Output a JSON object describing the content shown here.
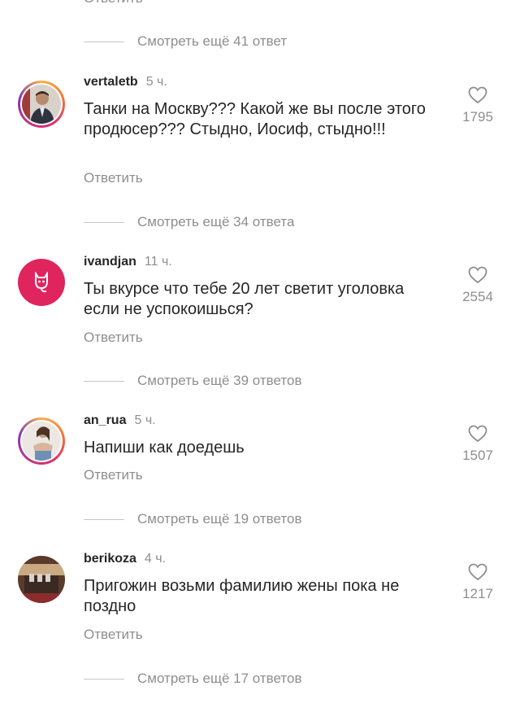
{
  "top_reply_label": "Ответить",
  "view_more": [
    "Смотреть ещё 41 ответ",
    "Смотреть ещё 34 ответа",
    "Смотреть ещё 39 ответов",
    "Смотреть ещё 19 ответов",
    "Смотреть ещё 17 ответов"
  ],
  "comments": [
    {
      "username": "vertaletb",
      "time": "5 ч.",
      "text": "Танки на Москву??? Какой же вы после этого продюсер??? Стыдно, Иосиф, стыдно!!!",
      "likes": "1795",
      "reply_label": "Ответить"
    },
    {
      "username": "ivandjan",
      "time": "11 ч.",
      "text": "Ты вкурсе что тебе 20 лет светит уголовка если не успокоишься?",
      "likes": "2554",
      "reply_label": "Ответить"
    },
    {
      "username": "an_rua",
      "time": "5 ч.",
      "text": "Напиши как доедешь",
      "likes": "1507",
      "reply_label": "Ответить"
    },
    {
      "username": "berikoza",
      "time": "4 ч.",
      "text": "Пригожин возьми фамилию жены пока не поздно",
      "likes": "1217",
      "reply_label": "Ответить"
    }
  ],
  "colors": {
    "secondary_text": "#8e8e8e",
    "primary_text": "#262626",
    "ivandjan_avatar_bg": "#e0245e"
  },
  "icons": {
    "like": "heart-outline-icon",
    "ivandjan_avatar": "cat-icon"
  }
}
